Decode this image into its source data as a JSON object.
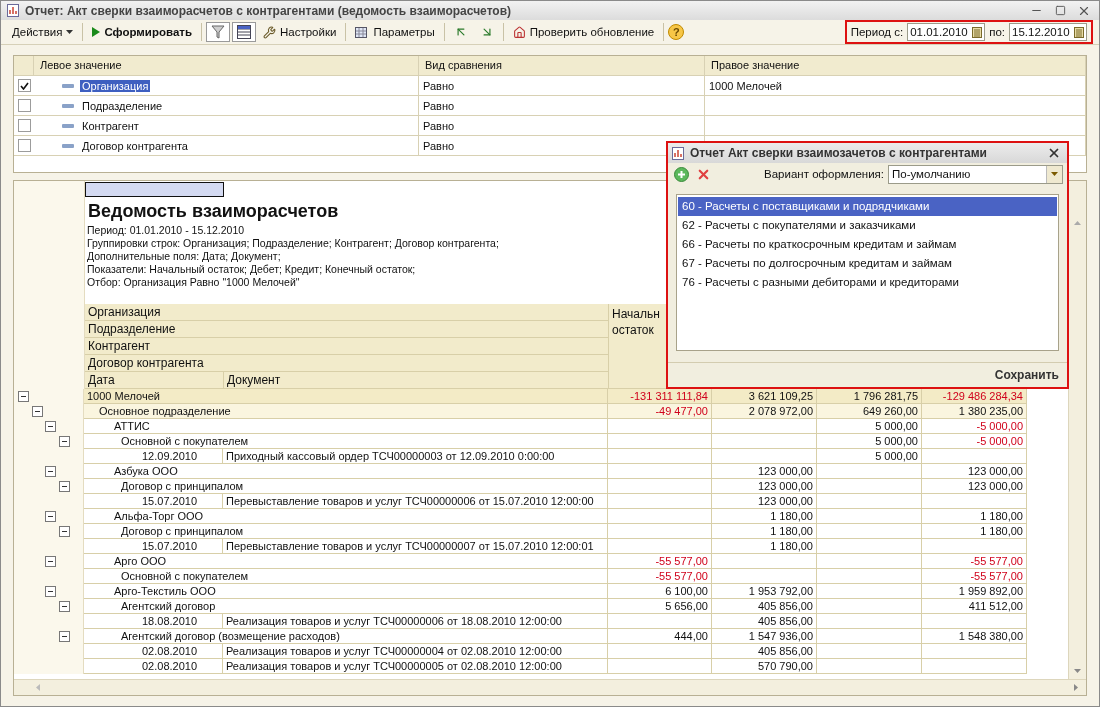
{
  "window": {
    "title": "Отчет: Акт сверки взаиморасчетов с контрагентами (ведомость взаиморасчетов)"
  },
  "toolbar": {
    "actions": "Действия",
    "generate": "Сформировать",
    "settings": "Настройки",
    "parameters": "Параметры",
    "check_update": "Проверить обновление",
    "help": "?"
  },
  "period": {
    "label_from": "Период с:",
    "from": "01.01.2010",
    "label_to": "по:",
    "to": "15.12.2010"
  },
  "filter": {
    "columns": [
      "Левое значение",
      "Вид сравнения",
      "Правое значение"
    ],
    "rows": [
      {
        "checked": true,
        "selected": true,
        "left": "Организация",
        "comparison": "Равно",
        "right": "1000 Мелочей"
      },
      {
        "checked": false,
        "selected": false,
        "left": "Подразделение",
        "comparison": "Равно"
      },
      {
        "checked": false,
        "selected": false,
        "left": "Контрагент",
        "comparison": "Равно"
      },
      {
        "checked": false,
        "selected": false,
        "left": "Договор контрагента",
        "comparison": "Равно"
      }
    ]
  },
  "report": {
    "title": "Ведомость взаиморасчетов",
    "info": [
      "Период: 01.01.2010 - 15.12.2010",
      "Группировки строк: Организация; Подразделение; Контрагент; Договор контрагента;",
      "Дополнительные поля: Дата; Документ;",
      "Показатели: Начальный остаток; Дебет; Кредит; Конечный остаток;",
      "Отбор: Организация Равно \"1000 Мелочей\""
    ],
    "header_groups": [
      "Организация",
      "Подразделение",
      "Контрагент",
      "Договор контрагента"
    ],
    "header_date": "Дата",
    "header_document": "Документ",
    "column_1": "Начальн остаток",
    "rows": [
      {
        "kind": "group",
        "label": "1000 Мелочей",
        "values": {
          "column_1": "-131 311 111,84",
          "column_2": "3 621 109,25",
          "column_3": "1 796 281,75",
          "column_4": "-129 486 284,34"
        },
        "expanded": true,
        "children": [
          {
            "kind": "group",
            "label": "Основное подразделение",
            "values": {
              "column_1": "-49 477,00",
              "column_2": "2 078 972,00",
              "column_3": "649 260,00",
              "column_4": "1 380 235,00"
            },
            "expanded": true,
            "children": [
              {
                "kind": "group",
                "label": "АТТИС",
                "values": {
                  "column_3": "5 000,00",
                  "column_4": "-5 000,00"
                },
                "expanded": true,
                "children": [
                  {
                    "kind": "group",
                    "label": "Основной с покупателем",
                    "values": {
                      "column_3": "5 000,00",
                      "column_4": "-5 000,00"
                    },
                    "expanded": true,
                    "children": [
                      {
                        "kind": "document",
                        "date": "12.09.2010",
                        "document": "Приходный кассовый ордер ТСЧ00000003 от 12.09.2010 0:00:00",
                        "values": {
                          "column_3": "5 000,00"
                        }
                      }
                    ]
                  }
                ]
              },
              {
                "kind": "group",
                "label": "Азбука ООО",
                "values": {
                  "column_2": "123 000,00",
                  "column_4": "123 000,00"
                },
                "expanded": true,
                "children": [
                  {
                    "kind": "group",
                    "label": "Договор с принципалом",
                    "values": {
                      "column_2": "123 000,00",
                      "column_4": "123 000,00"
                    },
                    "expanded": true,
                    "children": [
                      {
                        "kind": "document",
                        "date": "15.07.2010",
                        "document": "Перевыставление товаров и услуг ТСЧ00000006 от 15.07.2010 12:00:00",
                        "values": {
                          "column_2": "123 000,00"
                        }
                      }
                    ]
                  }
                ]
              },
              {
                "kind": "group",
                "label": "Альфа-Торг ООО",
                "values": {
                  "column_2": "1 180,00",
                  "column_4": "1 180,00"
                },
                "expanded": true,
                "children": [
                  {
                    "kind": "group",
                    "label": "Договор с принципалом",
                    "values": {
                      "column_2": "1 180,00",
                      "column_4": "1 180,00"
                    },
                    "expanded": true,
                    "children": [
                      {
                        "kind": "document",
                        "date": "15.07.2010",
                        "document": "Перевыставление товаров и услуг ТСЧ00000007 от 15.07.2010 12:00:01",
                        "values": {
                          "column_2": "1 180,00"
                        }
                      }
                    ]
                  }
                ]
              },
              {
                "kind": "group",
                "label": "Арго ООО",
                "values": {
                  "column_1": "-55 577,00",
                  "column_4": "-55 577,00"
                },
                "expanded": true,
                "children": [
                  {
                    "kind": "group",
                    "label": "Основной с покупателем",
                    "values": {
                      "column_1": "-55 577,00",
                      "column_4": "-55 577,00"
                    }
                  }
                ]
              },
              {
                "kind": "group",
                "label": "Арго-Текстиль ООО",
                "values": {
                  "column_1": "6 100,00",
                  "column_2": "1 953 792,00",
                  "column_4": "1 959 892,00"
                },
                "expanded": true,
                "children": [
                  {
                    "kind": "group",
                    "label": "Агентский договор",
                    "values": {
                      "column_1": "5 656,00",
                      "column_2": "405 856,00",
                      "column_4": "411 512,00"
                    },
                    "expanded": true,
                    "children": [
                      {
                        "kind": "document",
                        "date": "18.08.2010",
                        "document": "Реализация товаров и услуг ТСЧ00000006 от 18.08.2010 12:00:00",
                        "values": {
                          "column_2": "405 856,00"
                        }
                      }
                    ]
                  },
                  {
                    "kind": "group",
                    "label": "Агентский договор (возмещение расходов)",
                    "values": {
                      "column_1": "444,00",
                      "column_2": "1 547 936,00",
                      "column_4": "1 548 380,00"
                    },
                    "expanded": true,
                    "children": [
                      {
                        "kind": "document",
                        "date": "02.08.2010",
                        "document": "Реализация товаров и услуг ТСЧ00000004 от 02.08.2010 12:00:00",
                        "values": {
                          "column_2": "405 856,00"
                        }
                      },
                      {
                        "kind": "document",
                        "date": "02.08.2010",
                        "document": "Реализация товаров и услуг ТСЧ00000005 от 02.08.2010 12:00:00",
                        "values": {
                          "column_2": "570 790,00"
                        }
                      }
                    ]
                  }
                ]
              }
            ]
          }
        ]
      }
    ]
  },
  "dialog": {
    "title": "Отчет  Акт сверки взаимозачетов с контрагентами",
    "variant_label": "Вариант оформления:",
    "variant": "По-умолчанию",
    "items": [
      {
        "label": "60 - Расчеты с поставщиками и подрядчиками",
        "selected": true
      },
      {
        "label": "62 - Расчеты с покупателями и заказчиками",
        "selected": false
      },
      {
        "label": "66 - Расчеты по краткосрочным кредитам и займам",
        "selected": false
      },
      {
        "label": "67 - Расчеты по долгосрочным кредитам и займам",
        "selected": false
      },
      {
        "label": "76 - Расчеты с разными дебиторами и кредиторами",
        "selected": false
      }
    ],
    "save": "Сохранить"
  }
}
